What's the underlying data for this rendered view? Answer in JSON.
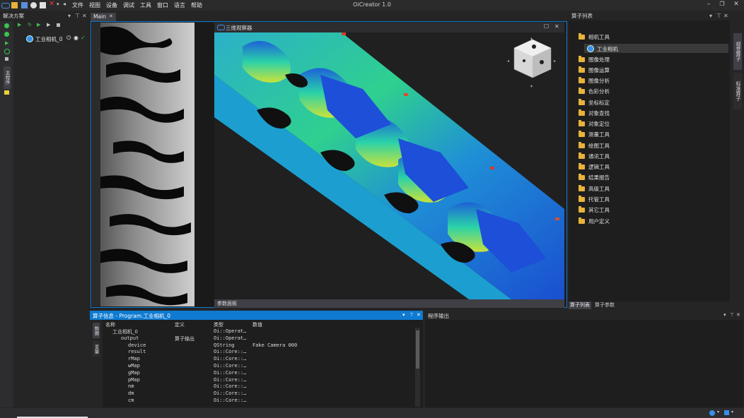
{
  "app": {
    "title": "OiCreator 1.0",
    "menu": [
      "文件",
      "视图",
      "设备",
      "调试",
      "工具",
      "窗口",
      "语言",
      "帮助"
    ]
  },
  "solution_panel": {
    "title": "解决方案",
    "item_label": "工业相机_0",
    "vertical_tab": "主程序"
  },
  "doc_tab": {
    "label": "Main"
  },
  "viewer3d": {
    "title": "三维观察器",
    "param_panel_label": "参数面板"
  },
  "operator_list": {
    "title": "算子列表",
    "items": [
      {
        "label": "相机工具",
        "expanded": true
      },
      {
        "label": "图像处理"
      },
      {
        "label": "图像运算"
      },
      {
        "label": "图像分析"
      },
      {
        "label": "色彩分析"
      },
      {
        "label": "坐标标定"
      },
      {
        "label": "对象查找"
      },
      {
        "label": "对象定位"
      },
      {
        "label": "测量工具"
      },
      {
        "label": "绘图工具"
      },
      {
        "label": "通讯工具"
      },
      {
        "label": "逻辑工具"
      },
      {
        "label": "结果报告"
      },
      {
        "label": "高级工具"
      },
      {
        "label": "托管工具"
      },
      {
        "label": "其它工具"
      },
      {
        "label": "用户定义"
      }
    ],
    "child_item": "工业相机",
    "bottom_tabs": [
      "算子列表",
      "算子参数"
    ],
    "right_vtabs": [
      "视觉算子",
      "标准算子"
    ]
  },
  "op_info": {
    "title": "算子信息 - Program.工业相机_0",
    "side_tabs": [
      "数据",
      "变量"
    ],
    "columns": [
      "名称",
      "定义",
      "类型",
      "数值"
    ],
    "rows": [
      {
        "name": "工业相机_0",
        "def": "",
        "type": "Oi::Operat…",
        "value": "",
        "indent": 1
      },
      {
        "name": "output",
        "def": "算子输出",
        "type": "Oi::Operat…",
        "value": "",
        "indent": 2
      },
      {
        "name": "device",
        "def": "",
        "type": "QString",
        "value": "Fake Camera 000",
        "indent": 3
      },
      {
        "name": "result",
        "def": "",
        "type": "Oi::Core::…",
        "value": "",
        "indent": 3
      },
      {
        "name": "rMap",
        "def": "",
        "type": "Oi::Core::…",
        "value": "",
        "indent": 3
      },
      {
        "name": "wMap",
        "def": "",
        "type": "Oi::Core::…",
        "value": "",
        "indent": 3
      },
      {
        "name": "gMap",
        "def": "",
        "type": "Oi::Core::…",
        "value": "",
        "indent": 3
      },
      {
        "name": "pMap",
        "def": "",
        "type": "Oi::Core::…",
        "value": "",
        "indent": 3
      },
      {
        "name": "nm",
        "def": "",
        "type": "Oi::Core::…",
        "value": "",
        "indent": 3
      },
      {
        "name": "dm",
        "def": "",
        "type": "Oi::Core::…",
        "value": "",
        "indent": 3
      },
      {
        "name": "cm",
        "def": "",
        "type": "Oi::Core::…",
        "value": "",
        "indent": 3
      }
    ]
  },
  "program_output": {
    "title": "程序输出"
  },
  "colors": {
    "accent": "#0e7ad1",
    "folder": "#e8b33a",
    "bg_dark": "#1e1e1e"
  }
}
